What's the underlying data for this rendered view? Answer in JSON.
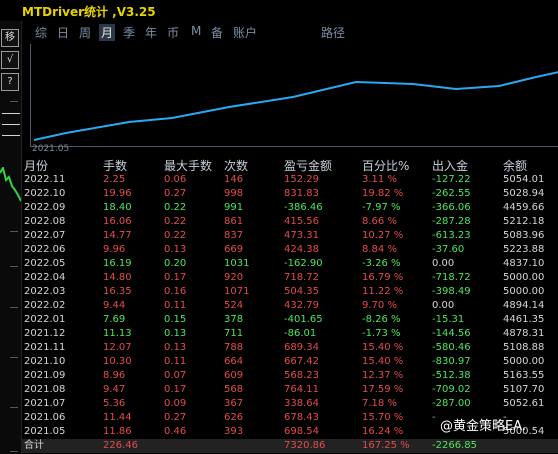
{
  "app": {
    "title": "MTDriver统计 ,V3.25"
  },
  "toolbar": {
    "buttons": [
      "移",
      "√",
      "?"
    ]
  },
  "tabs": [
    "综",
    "日",
    "周",
    "月",
    "季",
    "年",
    "币",
    "M",
    "备",
    "账户",
    "路径"
  ],
  "active_tab": "月",
  "chart": {
    "x_tick": "2021.05",
    "line_color": "#29a9f2"
  },
  "table": {
    "headers": [
      "月份",
      "手数",
      "最大手数",
      "次数",
      "盈亏金额",
      "百分比%",
      "出入金",
      "余额"
    ],
    "rows": [
      {
        "month": "2022.11",
        "lots": "2.25",
        "max_lots": "0.06",
        "count": "146",
        "pnl": "152.29",
        "pct": "3.11 %",
        "flow": "-127.22",
        "balance": "5054.01",
        "sign": "pos"
      },
      {
        "month": "2022.10",
        "lots": "19.96",
        "max_lots": "0.27",
        "count": "998",
        "pnl": "831.83",
        "pct": "19.82 %",
        "flow": "-262.55",
        "balance": "5028.94",
        "sign": "pos"
      },
      {
        "month": "2022.09",
        "lots": "18.40",
        "max_lots": "0.22",
        "count": "991",
        "pnl": "-386.46",
        "pct": "-7.97 %",
        "flow": "-366.06",
        "balance": "4459.66",
        "sign": "neg"
      },
      {
        "month": "2022.08",
        "lots": "16.06",
        "max_lots": "0.22",
        "count": "861",
        "pnl": "415.56",
        "pct": "8.66 %",
        "flow": "-287.28",
        "balance": "5212.18",
        "sign": "pos"
      },
      {
        "month": "2022.07",
        "lots": "14.77",
        "max_lots": "0.22",
        "count": "837",
        "pnl": "473.31",
        "pct": "10.27 %",
        "flow": "-613.23",
        "balance": "5083.96",
        "sign": "pos"
      },
      {
        "month": "2022.06",
        "lots": "9.96",
        "max_lots": "0.13",
        "count": "669",
        "pnl": "424.38",
        "pct": "8.84 %",
        "flow": "-37.60",
        "balance": "5223.88",
        "sign": "pos"
      },
      {
        "month": "2022.05",
        "lots": "16.19",
        "max_lots": "0.20",
        "count": "1031",
        "pnl": "-162.90",
        "pct": "-3.26 %",
        "flow": "0.00",
        "balance": "4837.10",
        "sign": "neg"
      },
      {
        "month": "2022.04",
        "lots": "14.80",
        "max_lots": "0.17",
        "count": "920",
        "pnl": "718.72",
        "pct": "16.79 %",
        "flow": "-718.72",
        "balance": "5000.00",
        "sign": "pos"
      },
      {
        "month": "2022.03",
        "lots": "16.35",
        "max_lots": "0.16",
        "count": "1071",
        "pnl": "504.35",
        "pct": "11.22 %",
        "flow": "-398.49",
        "balance": "5000.00",
        "sign": "pos"
      },
      {
        "month": "2022.02",
        "lots": "9.44",
        "max_lots": "0.11",
        "count": "524",
        "pnl": "432.79",
        "pct": "9.70 %",
        "flow": "0.00",
        "balance": "4894.14",
        "sign": "pos"
      },
      {
        "month": "2022.01",
        "lots": "7.69",
        "max_lots": "0.15",
        "count": "378",
        "pnl": "-401.65",
        "pct": "-8.26 %",
        "flow": "-15.31",
        "balance": "4461.35",
        "sign": "neg"
      },
      {
        "month": "2021.12",
        "lots": "11.13",
        "max_lots": "0.13",
        "count": "711",
        "pnl": "-86.01",
        "pct": "-1.73 %",
        "flow": "-144.56",
        "balance": "4878.31",
        "sign": "neg"
      },
      {
        "month": "2021.11",
        "lots": "12.07",
        "max_lots": "0.13",
        "count": "788",
        "pnl": "689.34",
        "pct": "15.40 %",
        "flow": "-580.46",
        "balance": "5108.88",
        "sign": "pos"
      },
      {
        "month": "2021.10",
        "lots": "10.30",
        "max_lots": "0.11",
        "count": "664",
        "pnl": "667.42",
        "pct": "15.40 %",
        "flow": "-830.97",
        "balance": "5000.00",
        "sign": "pos"
      },
      {
        "month": "2021.09",
        "lots": "8.96",
        "max_lots": "0.07",
        "count": "609",
        "pnl": "568.23",
        "pct": "12.37 %",
        "flow": "-512.38",
        "balance": "5163.55",
        "sign": "pos"
      },
      {
        "month": "2021.08",
        "lots": "9.47",
        "max_lots": "0.17",
        "count": "568",
        "pnl": "764.11",
        "pct": "17.59 %",
        "flow": "-709.02",
        "balance": "5107.70",
        "sign": "pos"
      },
      {
        "month": "2021.07",
        "lots": "5.36",
        "max_lots": "0.09",
        "count": "367",
        "pnl": "338.64",
        "pct": "7.18 %",
        "flow": "-287.00",
        "balance": "5052.61",
        "sign": "pos"
      },
      {
        "month": "2021.06",
        "lots": "11.44",
        "max_lots": "0.27",
        "count": "626",
        "pnl": "678.43",
        "pct": "15.70 %",
        "flow": "-",
        "balance": "-",
        "sign": "pos"
      },
      {
        "month": "2021.05",
        "lots": "11.86",
        "max_lots": "0.46",
        "count": "393",
        "pnl": "698.54",
        "pct": "16.24 %",
        "flow": "",
        "balance": "5000.54",
        "sign": "pos"
      }
    ],
    "total": {
      "label": "合计",
      "lots": "226.46",
      "pnl": "7320.86",
      "pct": "167.25 %",
      "flow": "-2266.85"
    }
  },
  "watermark": {
    "text": "@黄金策略EA."
  }
}
